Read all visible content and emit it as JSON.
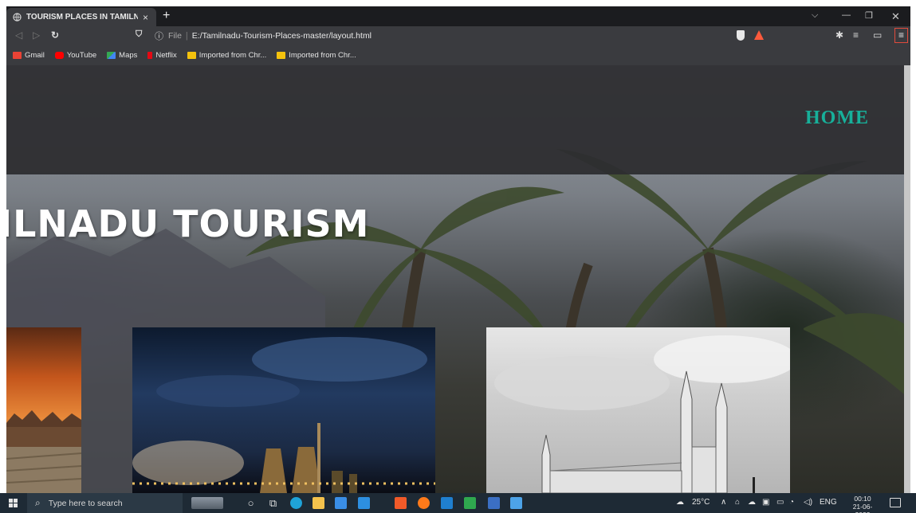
{
  "browser": {
    "tab_title": "TOURISM PLACES IN TAMILNADU",
    "tab_close": "×",
    "new_tab": "+",
    "address": {
      "scheme_label": "File",
      "separator": "|",
      "url": "E:/Tamilnadu-Tourism-Places-master/layout.html"
    },
    "bookmarks": [
      {
        "label": "Gmail",
        "color": "#ea4335"
      },
      {
        "label": "YouTube",
        "color": "#ff0000"
      },
      {
        "label": "Maps",
        "color": "#34a853"
      },
      {
        "label": "Netflix",
        "color": "#e50914"
      },
      {
        "label": "Imported from Chr...",
        "color": "#f4c20d"
      },
      {
        "label": "Imported from Chr...",
        "color": "#f4c20d"
      }
    ]
  },
  "page": {
    "nav": {
      "home_label": "HOME",
      "home_color": "#17b09a"
    },
    "hero_title": "ILNADU TOURISM"
  },
  "taskbar": {
    "search_placeholder": "Type here to search",
    "weather": "25°C",
    "language": "ENG",
    "time": "00:10",
    "date": "21-06-2022"
  }
}
